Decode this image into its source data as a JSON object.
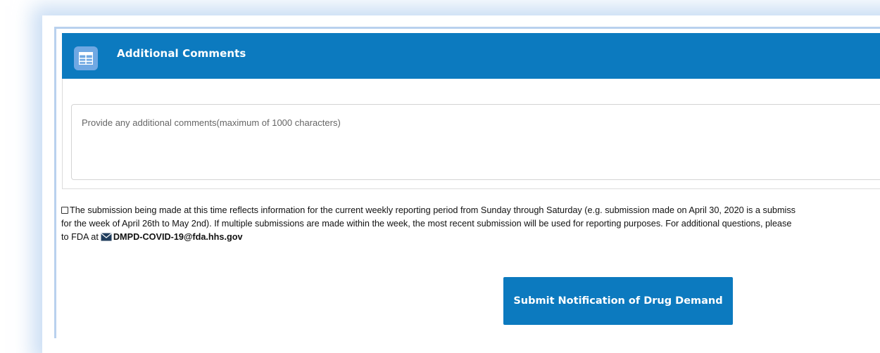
{
  "panel": {
    "title": "Additional Comments",
    "icon": "table-icon",
    "header_color": "#0c7abf"
  },
  "comments": {
    "placeholder": "Provide any additional comments(maximum of 1000 characters)",
    "value": ""
  },
  "acknowledgement": {
    "checked": false,
    "line1": "The submission being made at this time reflects information for the current weekly reporting period from Sunday through Saturday (e.g. submission made on April 30, 2020 is a submiss",
    "line2": "for the week of April 26th to May 2nd). If multiple submissions are made within the week, the most recent submission will be used for reporting purposes. For additional questions, please",
    "line3_prefix": "to FDA at",
    "email_icon": "envelope-icon",
    "email": "DMPD-COVID-19@fda.hhs.gov"
  },
  "submit": {
    "label": "Submit Notification of Drug Demand",
    "color": "#0c7abf"
  }
}
